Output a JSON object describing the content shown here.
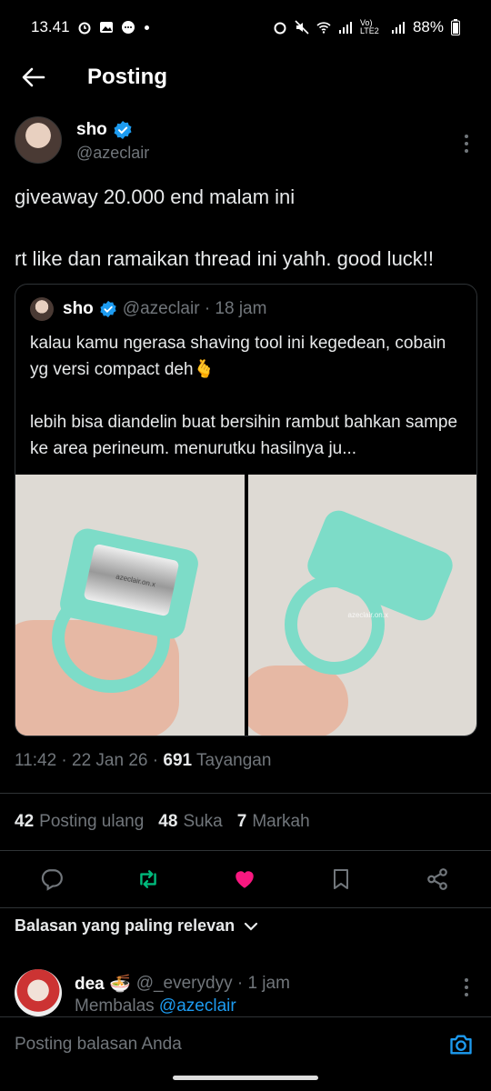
{
  "status_bar": {
    "time": "13.41",
    "battery": "88%",
    "network": "Vo) LTE2"
  },
  "header": {
    "title": "Posting"
  },
  "post": {
    "author_name": "sho",
    "author_handle": "@azeclair",
    "text": "giveaway 20.000 end malam ini\n\nrt like dan ramaikan thread ini yahh. good luck!!",
    "quote": {
      "name": "sho",
      "meta": "@azeclair · 18 jam",
      "text": "kalau kamu ngerasa shaving tool ini kegedean, cobain yg versi compact deh🫰\n\nlebih bisa diandelin buat bersihin rambut bahkan sampe ke area perineum. menurutku hasilnya ju...",
      "watermark": "azeclair.on.x"
    },
    "time": "11:42 · 22 Jan 26 · ",
    "views": "691",
    "views_label": " Tayangan",
    "stats": {
      "reposts": "42",
      "reposts_label": "Posting ulang",
      "likes": "48",
      "likes_label": "Suka",
      "bookmarks": "7",
      "bookmarks_label": "Markah"
    }
  },
  "replies": {
    "heading": "Balasan yang paling relevan",
    "items": [
      {
        "name": "dea 🍜",
        "meta": "@_everydyy · 1 jam",
        "replying_prefix": "Membalas ",
        "replying_to": "@azeclair"
      }
    ]
  },
  "compose": {
    "placeholder": "Posting balasan Anda"
  },
  "colors": {
    "accent": "#1d9bf0",
    "repost": "#00ba7c",
    "like": "#f91880",
    "muted": "#71767b"
  }
}
